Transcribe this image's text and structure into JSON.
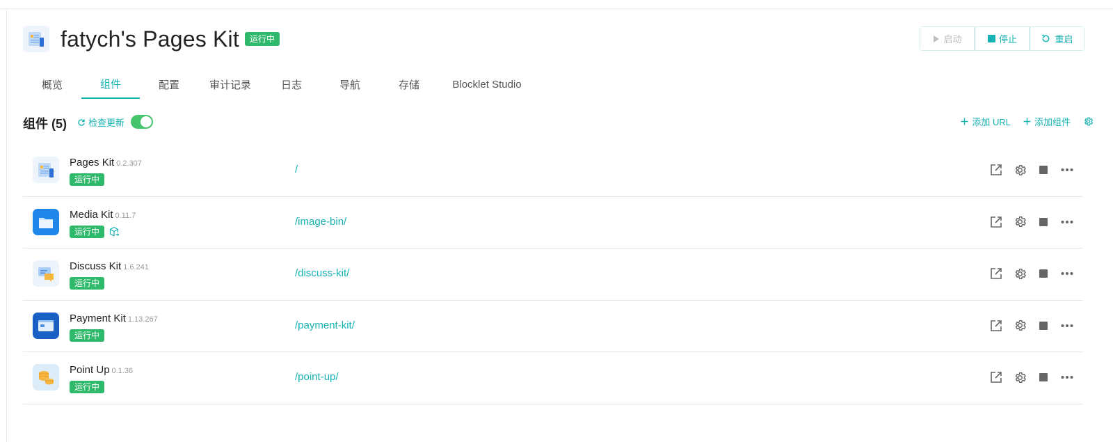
{
  "header": {
    "title": "fatych's Pages Kit",
    "status": "运行中",
    "actions": {
      "start": "启动",
      "stop": "停止",
      "restart": "重启"
    }
  },
  "tabs": [
    {
      "label": "概览"
    },
    {
      "label": "组件",
      "active": true
    },
    {
      "label": "配置"
    },
    {
      "label": "审计记录"
    },
    {
      "label": "日志"
    },
    {
      "label": "导航"
    },
    {
      "label": "存储"
    },
    {
      "label": "Blocklet Studio"
    }
  ],
  "section": {
    "title": "组件 (5)",
    "check_update": "检查更新",
    "auto_update_enabled": true,
    "add_url": "添加 URL",
    "add_component": "添加组件"
  },
  "components": [
    {
      "name": "Pages Kit",
      "version": "0.2.307",
      "status": "运行中",
      "path": "/",
      "icon": "pages-kit-icon"
    },
    {
      "name": "Media Kit",
      "version": "0.11.7",
      "status": "运行中",
      "path": "/image-bin/",
      "icon": "media-kit-icon",
      "has_update_icon": true
    },
    {
      "name": "Discuss Kit",
      "version": "1.6.241",
      "status": "运行中",
      "path": "/discuss-kit/",
      "icon": "discuss-kit-icon"
    },
    {
      "name": "Payment Kit",
      "version": "1.13.267",
      "status": "运行中",
      "path": "/payment-kit/",
      "icon": "payment-kit-icon"
    },
    {
      "name": "Point Up",
      "version": "0.1.36",
      "status": "运行中",
      "path": "/point-up/",
      "icon": "point-up-icon"
    }
  ],
  "colors": {
    "accent": "#17b2b3",
    "running": "#2fb96b",
    "toggle": "#45c46b"
  }
}
